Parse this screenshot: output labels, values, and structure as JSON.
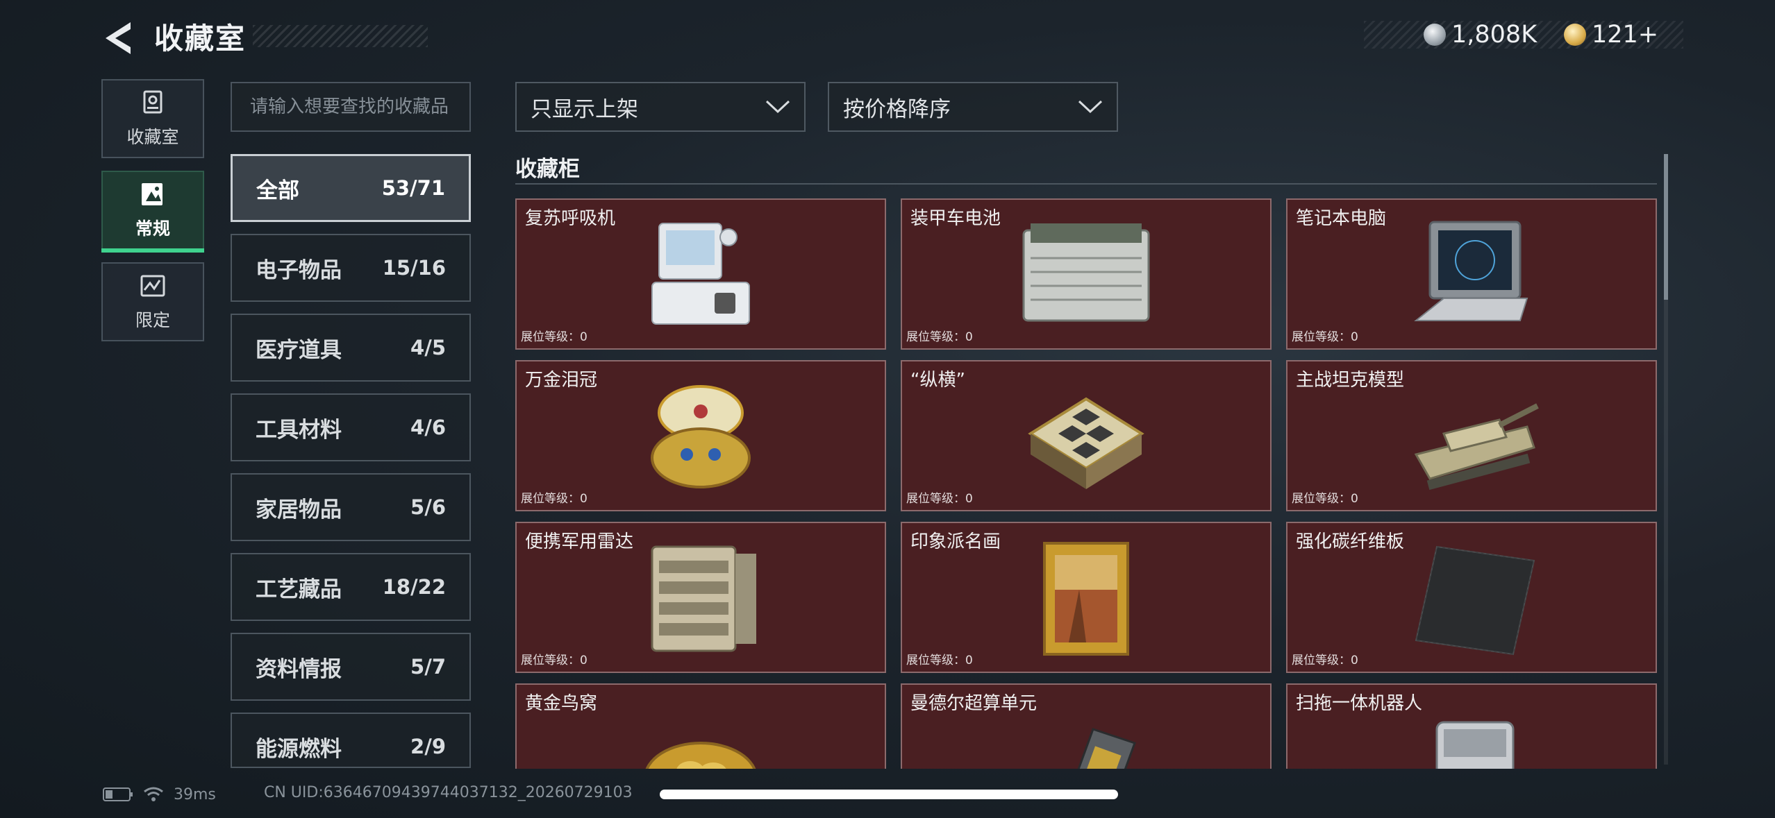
{
  "header": {
    "title": "收藏室",
    "currency": [
      {
        "icon": "silver-coin-icon",
        "value": "1,808K"
      },
      {
        "icon": "gold-coin-icon",
        "value": "121+"
      }
    ]
  },
  "nav": [
    {
      "label": "收藏室",
      "icon": "collection-room-icon",
      "active": false
    },
    {
      "label": "常规",
      "icon": "regular-icon",
      "active": true
    },
    {
      "label": "限定",
      "icon": "limited-icon",
      "active": false
    }
  ],
  "search": {
    "placeholder": "请输入想要查找的收藏品"
  },
  "categories": [
    {
      "name": "全部",
      "count": "53/71",
      "active": true
    },
    {
      "name": "电子物品",
      "count": "15/16"
    },
    {
      "name": "医疗道具",
      "count": "4/5"
    },
    {
      "name": "工具材料",
      "count": "4/6"
    },
    {
      "name": "家居物品",
      "count": "5/6"
    },
    {
      "name": "工艺藏品",
      "count": "18/22"
    },
    {
      "name": "资料情报",
      "count": "5/7"
    },
    {
      "name": "能源燃料",
      "count": "2/9"
    }
  ],
  "filters": {
    "show": "只显示上架",
    "sort": "按价格降序"
  },
  "section": {
    "title": "收藏柜"
  },
  "items": [
    {
      "name": "复苏呼吸机",
      "level": "展位等级：0",
      "icon": "ventilator-icon"
    },
    {
      "name": "装甲车电池",
      "level": "展位等级：0",
      "icon": "battery-icon"
    },
    {
      "name": "笔记本电脑",
      "level": "展位等级：0",
      "icon": "laptop-icon"
    },
    {
      "name": "万金泪冠",
      "level": "展位等级：0",
      "icon": "jeweled-egg-icon"
    },
    {
      "name": "“纵横”",
      "level": "展位等级：0",
      "icon": "chessboard-icon"
    },
    {
      "name": "主战坦克模型",
      "level": "展位等级：0",
      "icon": "tank-model-icon"
    },
    {
      "name": "便携军用雷达",
      "level": "展位等级：0",
      "icon": "radar-icon"
    },
    {
      "name": "印象派名画",
      "level": "展位等级：0",
      "icon": "painting-icon"
    },
    {
      "name": "强化碳纤维板",
      "level": "展位等级：0",
      "icon": "carbon-plate-icon"
    },
    {
      "name": "黄金鸟窝",
      "level": "",
      "icon": "golden-nest-icon"
    },
    {
      "name": "曼德尔超算单元",
      "level": "",
      "icon": "compute-unit-icon"
    },
    {
      "name": "扫拖一体机器人",
      "level": "",
      "icon": "robot-vacuum-icon"
    }
  ],
  "status": {
    "ping": "39ms",
    "uid": "CN UID:63646709439744037132_20260729103"
  }
}
